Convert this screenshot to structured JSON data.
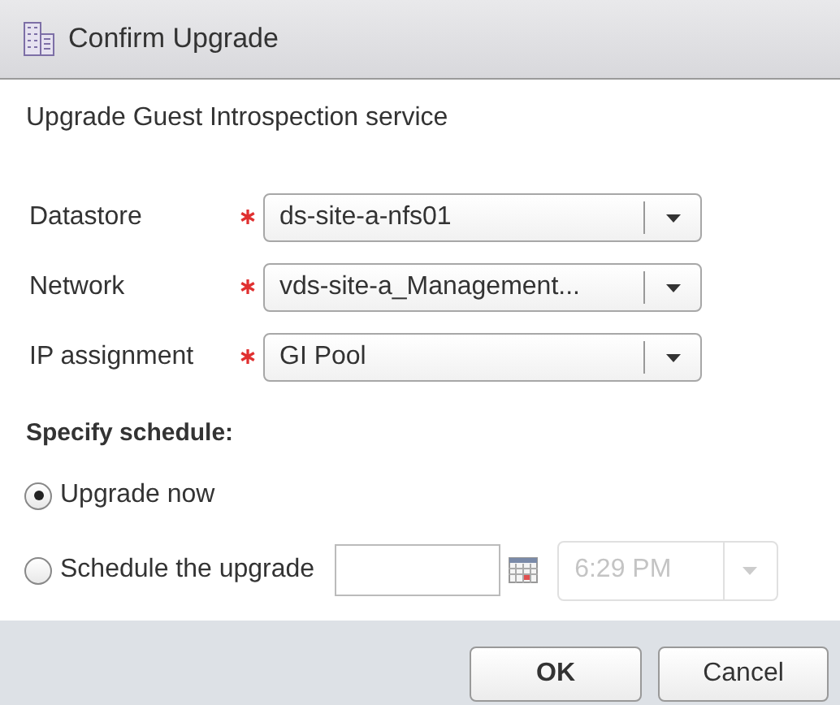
{
  "window": {
    "title": "Confirm Upgrade"
  },
  "description": "Upgrade Guest Introspection service",
  "fields": [
    {
      "label": "Datastore",
      "required": true,
      "value": "ds-site-a-nfs01"
    },
    {
      "label": "Network",
      "required": true,
      "value": "vds-site-a_Management..."
    },
    {
      "label": "IP assignment",
      "required": true,
      "value": "GI Pool"
    }
  ],
  "schedule": {
    "heading": "Specify schedule:",
    "options": [
      {
        "label": "Upgrade now",
        "selected": true
      },
      {
        "label": "Schedule the upgrade",
        "selected": false
      }
    ],
    "time": {
      "value": "6:29 PM",
      "disabled": true
    }
  },
  "buttons": [
    "OK",
    "Cancel"
  ]
}
